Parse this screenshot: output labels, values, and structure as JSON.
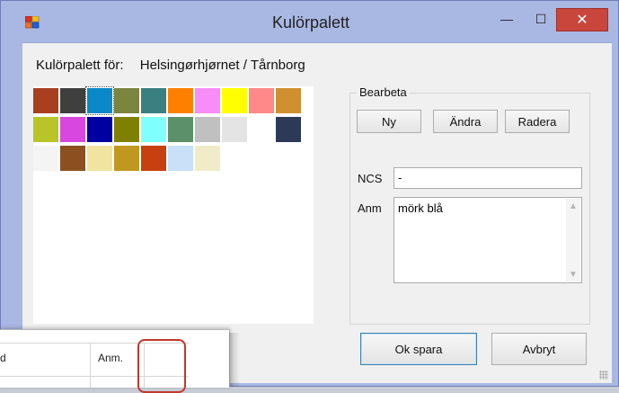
{
  "window": {
    "title": "Kulörpalett",
    "minimize_glyph": "—",
    "maximize_glyph": "☐",
    "close_glyph": "✕"
  },
  "palette_for": {
    "label": "Kulörpalett för:",
    "name": "Helsingørhjørnet / Tårnborg"
  },
  "swatches": [
    {
      "color": "#a84020"
    },
    {
      "color": "#3f3f3f"
    },
    {
      "color": "#0a88c8",
      "selected": true
    },
    {
      "color": "#7a8540"
    },
    {
      "color": "#3a8080"
    },
    {
      "color": "#ff8000"
    },
    {
      "color": "#f88cf8"
    },
    {
      "color": "#ffff00"
    },
    {
      "color": "#ff8888"
    },
    {
      "color": "#d09030"
    },
    {
      "color": "#b8c428"
    },
    {
      "color": "#d848e0"
    },
    {
      "color": "#0000a0"
    },
    {
      "color": "#808000"
    },
    {
      "color": "#80ffff"
    },
    {
      "color": "#5c9068"
    },
    {
      "color": "#c0c0c0"
    },
    {
      "color": "#e4e4e4"
    },
    {
      "color": "#ffffff"
    },
    {
      "color": "#2c3a58"
    },
    {
      "color": "#f4f4f4"
    },
    {
      "color": "#8c5020"
    },
    {
      "color": "#f0e4a0"
    },
    {
      "color": "#c09820"
    },
    {
      "color": "#c84010"
    },
    {
      "color": "#c8e0f8"
    },
    {
      "color": "#f0ecc8"
    }
  ],
  "edit_group": {
    "label": "Bearbeta",
    "new_label": "Ny",
    "change_label": "Ändra",
    "delete_label": "Radera"
  },
  "fields": {
    "ncs_label": "NCS",
    "ncs_value": "-",
    "anm_label": "Anm",
    "anm_value": "mörk blå"
  },
  "actions": {
    "ok_label": "Ok spara",
    "cancel_label": "Avbryt"
  },
  "background_window": {
    "col_partial": "d",
    "col_anm": "Anm."
  },
  "colors": {
    "titlebar": "#a9b7e3",
    "close_button": "#c9463d",
    "highlight": "#c0392b"
  }
}
